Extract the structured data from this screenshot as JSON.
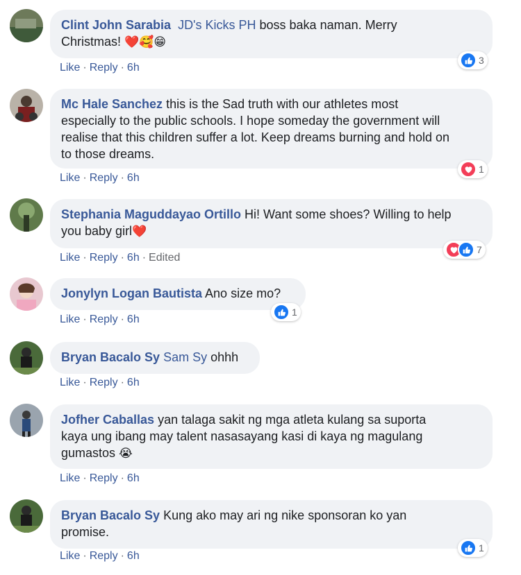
{
  "comments": [
    {
      "author": "Clint John Sarabia",
      "mention": "JD's Kicks PH",
      "text": " boss baka naman. Merry",
      "text2": "Christmas! ",
      "emoji": "❤️🥰😁",
      "actions": {
        "like": "Like",
        "reply": "Reply",
        "time": "6h"
      },
      "reactions": {
        "icons": [
          "like"
        ],
        "count": "3"
      }
    },
    {
      "author": "Mc Hale Sanchez",
      "text": " this is the Sad truth with our athletes most",
      "text2": "especially to the public schools. I hope someday the government will",
      "text3": "realise that this children suffer a lot. Keep dreams burning and hold on",
      "text4": "to those dreams.",
      "actions": {
        "like": "Like",
        "reply": "Reply",
        "time": "6h"
      },
      "reactions": {
        "icons": [
          "love"
        ],
        "count": "1"
      }
    },
    {
      "author": "Stephania Maguddayao Ortillo",
      "text": " Hi! Want some shoes? Willing to help",
      "text2": "you baby girl",
      "emoji": "❤️",
      "actions": {
        "like": "Like",
        "reply": "Reply",
        "time": "6h",
        "edited": "Edited"
      },
      "reactions": {
        "icons": [
          "love",
          "like"
        ],
        "count": "7"
      }
    },
    {
      "author": "Jonylyn Logan Bautista",
      "text": " Ano size mo?",
      "actions": {
        "like": "Like",
        "reply": "Reply",
        "time": "6h"
      },
      "reactions": {
        "icons": [
          "like"
        ],
        "count": "1"
      }
    },
    {
      "author": "Bryan Bacalo Sy",
      "mention": "Sam Sy",
      "text": " ohhh",
      "actions": {
        "like": "Like",
        "reply": "Reply",
        "time": "6h"
      }
    },
    {
      "author": "Jofher Caballas",
      "text": " yan talaga sakit ng mga atleta kulang sa suporta",
      "text2": "kaya ung ibang may talent nasasayang kasi di kaya ng magulang",
      "text3": "gumastos ",
      "emoji": "😭",
      "actions": {
        "like": "Like",
        "reply": "Reply",
        "time": "6h"
      }
    },
    {
      "author": "Bryan Bacalo Sy",
      "text": " Kung ako may ari ng nike sponsoran ko yan",
      "text2": "promise.",
      "actions": {
        "like": "Like",
        "reply": "Reply",
        "time": "6h"
      },
      "reactions": {
        "icons": [
          "like"
        ],
        "count": "1"
      }
    }
  ],
  "separator": "·",
  "colors": {
    "link": "#385898",
    "bubble": "#f0f2f5",
    "like": "#1877f2",
    "love": "#f33e58"
  }
}
